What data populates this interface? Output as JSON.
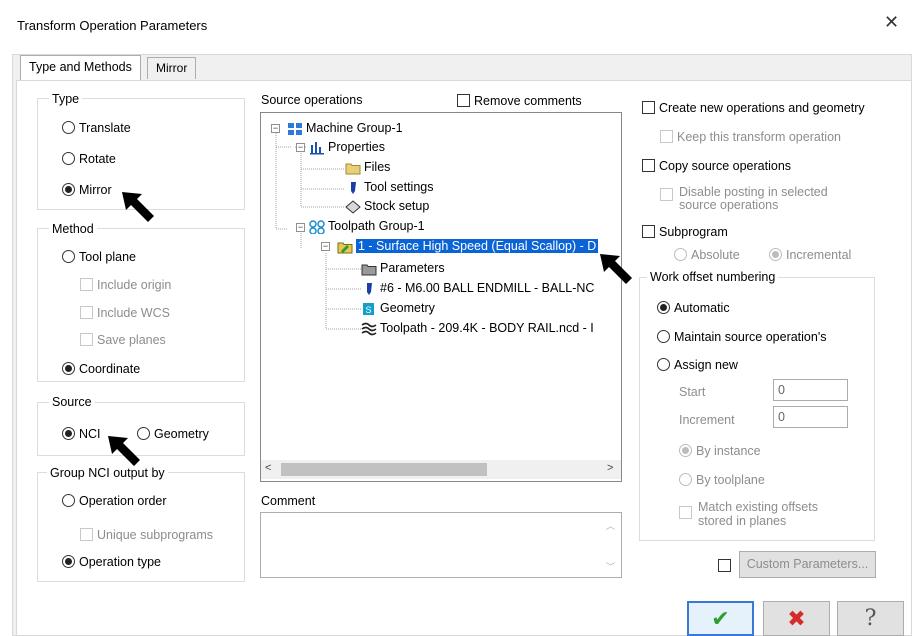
{
  "window": {
    "title": "Transform Operation Parameters"
  },
  "tabs": [
    {
      "label": "Type and Methods"
    },
    {
      "label": "Mirror"
    }
  ],
  "type_group": {
    "label": "Type",
    "options": [
      "Translate",
      "Rotate",
      "Mirror"
    ],
    "selected": "Mirror"
  },
  "method_group": {
    "label": "Method",
    "tool_plane": "Tool plane",
    "include_origin": "Include origin",
    "include_wcs": "Include WCS",
    "save_planes": "Save planes",
    "coordinate": "Coordinate",
    "selected": "Coordinate"
  },
  "source_group": {
    "label": "Source",
    "nci": "NCI",
    "geometry": "Geometry",
    "selected": "NCI"
  },
  "group_nci": {
    "label": "Group NCI output by",
    "operation_order": "Operation order",
    "unique_subprograms": "Unique subprograms",
    "operation_type": "Operation type",
    "selected": "Operation type"
  },
  "source_operations": {
    "label": "Source operations",
    "remove_comments": "Remove comments",
    "tree": {
      "machine_group": "Machine Group-1",
      "properties": "Properties",
      "files": "Files",
      "tool_settings": "Tool settings",
      "stock_setup": "Stock setup",
      "toolpath_group": "Toolpath Group-1",
      "operation": "1 - Surface High Speed (Equal Scallop) - D",
      "parameters": "Parameters",
      "tool": "#6 - M6.00 BALL ENDMILL - BALL-NC",
      "geometry": "Geometry",
      "toolpath": "Toolpath - 209.4K - BODY RAIL.ncd - I"
    }
  },
  "comment": {
    "label": "Comment",
    "value": ""
  },
  "right_panel": {
    "create_new": "Create new operations and geometry",
    "keep_transform": "Keep this transform operation",
    "copy_source": "Copy source operations",
    "disable_posting": "Disable posting in selected source operations",
    "subprogram": "Subprogram",
    "absolute": "Absolute",
    "incremental": "Incremental",
    "work_offset_label": "Work offset numbering",
    "automatic": "Automatic",
    "maintain": "Maintain source operation's",
    "assign_new": "Assign new",
    "start_label": "Start",
    "start_value": "0",
    "increment_label": "Increment",
    "increment_value": "0",
    "by_instance": "By instance",
    "by_toolplane": "By toolplane",
    "match_existing": "Match existing offsets stored in planes",
    "custom_parameters": "Custom Parameters..."
  },
  "buttons": {
    "ok": "✔",
    "cancel": "✖",
    "help": "?"
  },
  "colors": {
    "selection": "#0a64d6",
    "ok_green": "#2e9e2e",
    "cancel_red": "#d42b2b",
    "focus_border": "#3a78d6"
  }
}
